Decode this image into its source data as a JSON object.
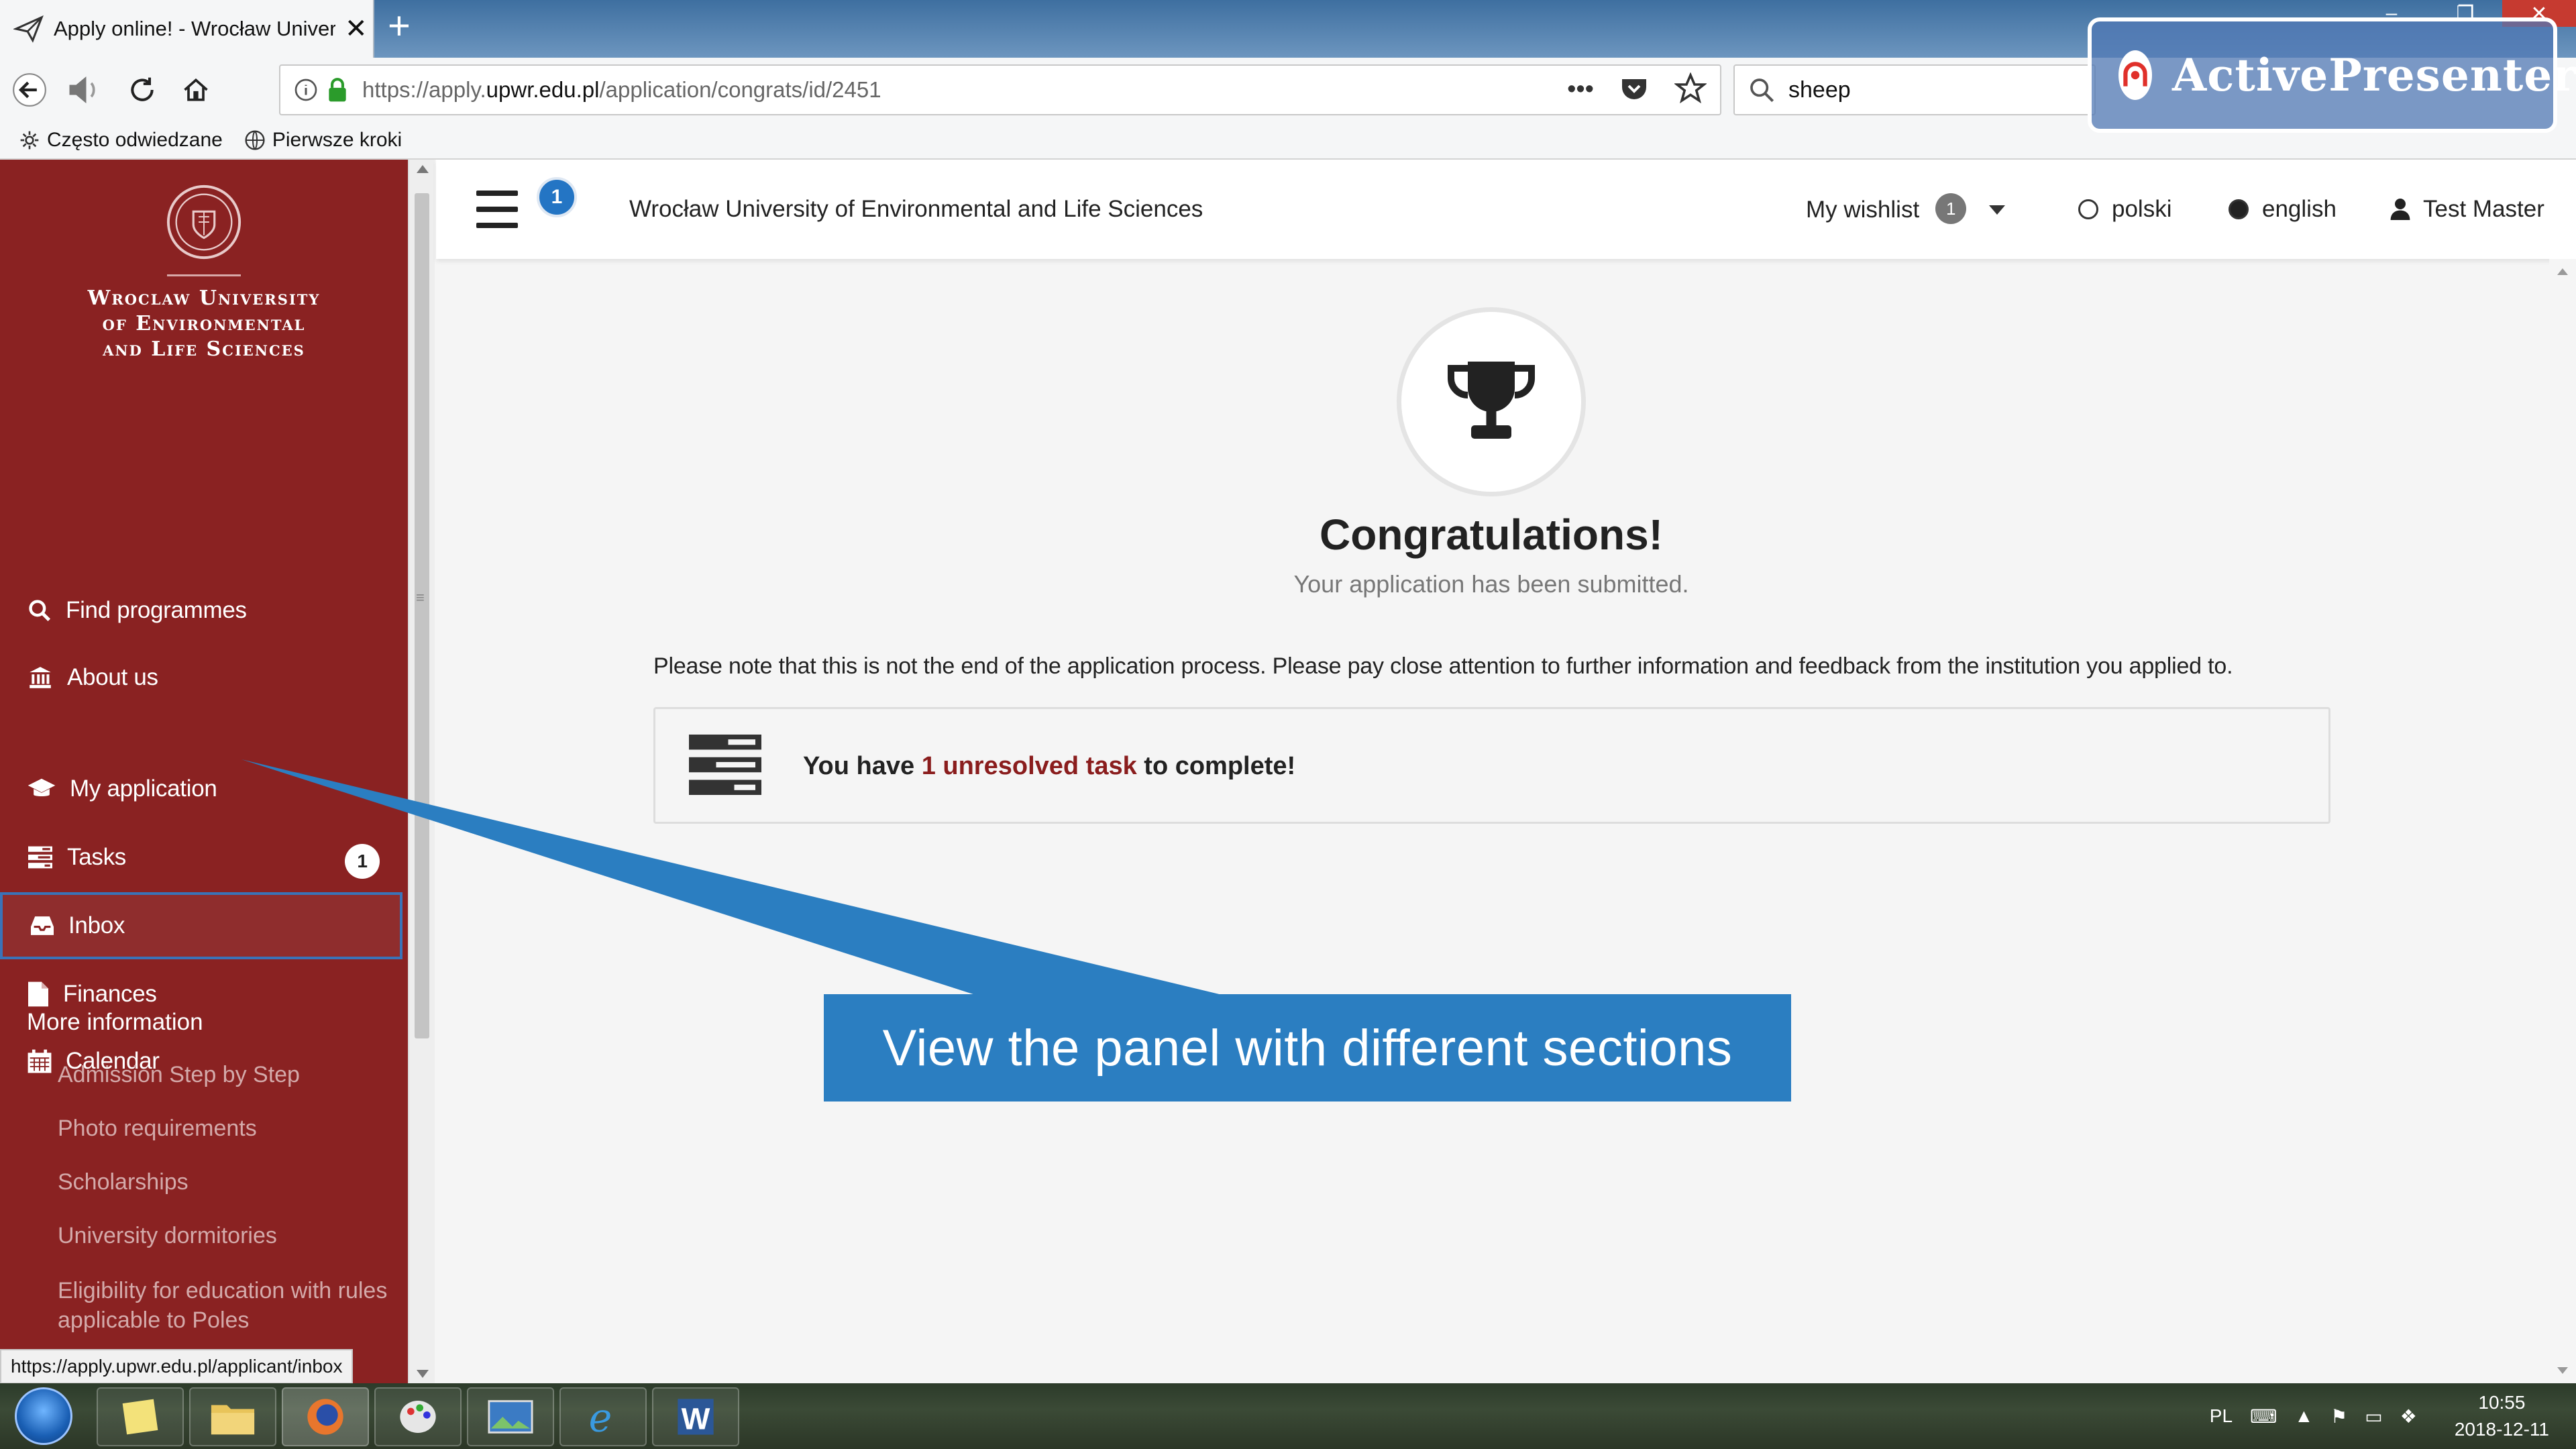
{
  "browser": {
    "tab_title": "Apply online! - Wrocław Univer",
    "url_prefix": "https://apply.",
    "url_domain": "upwr.edu.pl",
    "url_path": "/application/congrats/id/2451",
    "search_value": "sheep",
    "bookmarks": [
      {
        "label": "Często odwiedzane",
        "icon": "gear-icon"
      },
      {
        "label": "Pierwsze kroki",
        "icon": "globe-icon"
      }
    ],
    "status_url": "https://apply.upwr.edu.pl/applicant/inbox"
  },
  "watermark": {
    "text": "ActivePresenter"
  },
  "sidebar": {
    "university_name_lines": [
      "Wroclaw University",
      "of Environmental",
      "and Life Sciences"
    ],
    "items": [
      {
        "label": "Find programmes",
        "icon": "search-icon"
      },
      {
        "label": "About us",
        "icon": "institution-icon"
      },
      {
        "label": "My application",
        "icon": "graduation-cap-icon"
      },
      {
        "label": "Tasks",
        "icon": "tasks-icon",
        "badge": "1"
      },
      {
        "label": "Inbox",
        "icon": "inbox-icon"
      },
      {
        "label": "Finances",
        "icon": "document-icon"
      },
      {
        "label": "Calendar",
        "icon": "calendar-icon"
      }
    ],
    "more_title": "More information",
    "more_items": [
      "Admission Step by Step",
      "Photo requirements",
      "Scholarships",
      "University dormitories",
      "Eligibility for education with rules applicable to Poles"
    ]
  },
  "topbar": {
    "notification_count": "1",
    "site_title": "Wrocław University of Environmental and Life Sciences",
    "wishlist_label": "My wishlist",
    "wishlist_count": "1",
    "lang_options": [
      {
        "label": "polski",
        "selected": false
      },
      {
        "label": "english",
        "selected": true
      }
    ],
    "user_name": "Test Master"
  },
  "main": {
    "title": "Congratulations!",
    "subtitle": "Your application has been submitted.",
    "notice": "Please note that this is not the end of the application process. Please pay close attention to further information and feedback from the institution you applied to.",
    "task_prefix": "You have ",
    "task_link": "1 unresolved task",
    "task_suffix": " to complete!"
  },
  "callout": {
    "text": "View the panel with different sections"
  },
  "taskbar": {
    "lang": "PL",
    "time": "10:55",
    "date": "2018-12-11"
  },
  "colors": {
    "sidebar_bg": "#8a2222",
    "accent_blue": "#2475c4",
    "callout_blue": "#2b7ec1",
    "task_link": "#8a1d1d"
  }
}
